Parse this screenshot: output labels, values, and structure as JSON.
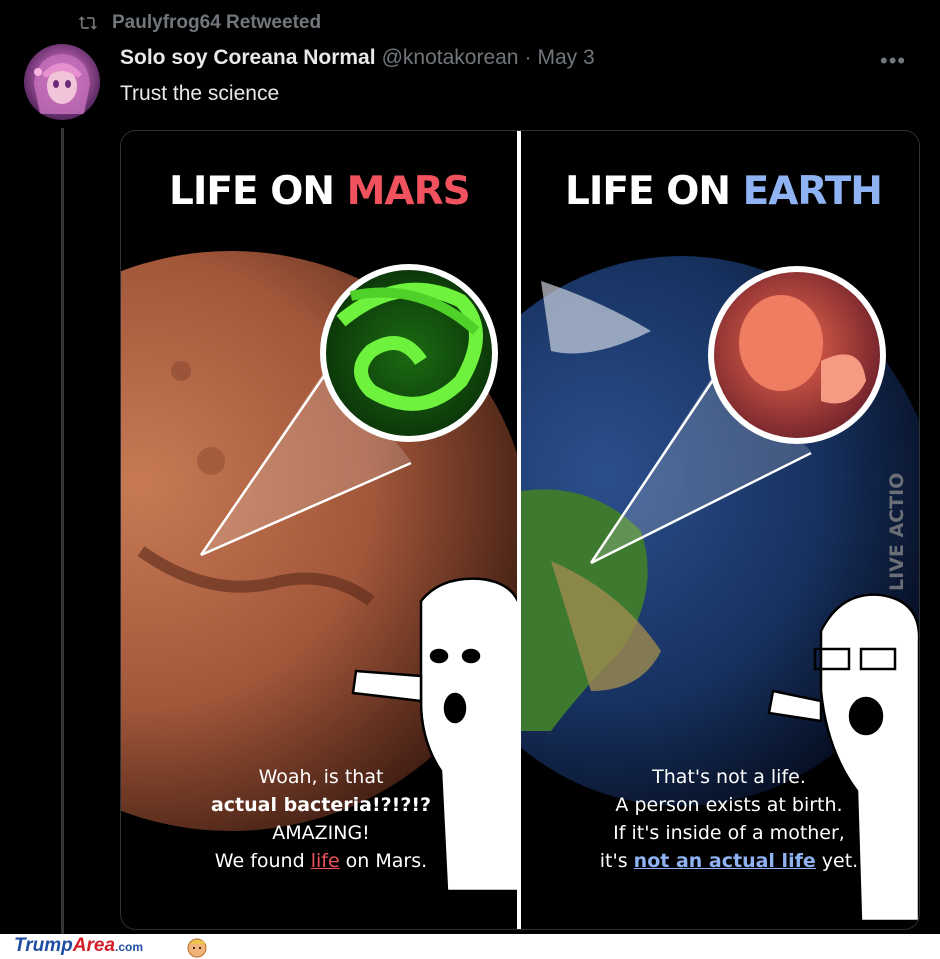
{
  "retweet": {
    "label": "Paulyfrog64 Retweeted",
    "icon": "retweet-icon"
  },
  "tweet": {
    "display_name": "Solo soy Coreana Normal",
    "handle": "@knotakorean",
    "separator": "·",
    "date": "May 3",
    "more_label": "•••",
    "text": "Trust the science"
  },
  "meme": {
    "left": {
      "title_a": "LIFE ON ",
      "title_b": "MARS",
      "line1": "Woah, is that",
      "line2": "actual bacteria!?!?!?",
      "line3": "AMAZING!",
      "line4a": "We found ",
      "line4b": "life",
      "line4c": " on Mars."
    },
    "right": {
      "title_a": "LIFE ON ",
      "title_b": "EARTH",
      "line1": "That's not a life.",
      "line2": "A person exists at birth.",
      "line3": "If it's inside of a mother,",
      "line4a": "it's ",
      "line4b": "not an actual life",
      "line4c": " yet."
    },
    "watermark": "LIVE ACTION"
  },
  "footer": {
    "brand_a": "Trump",
    "brand_b": "Area",
    "brand_c": ".com"
  },
  "colors": {
    "accent_red": "#f0525e",
    "accent_blue": "#8fb3f2",
    "bg": "#000000"
  }
}
